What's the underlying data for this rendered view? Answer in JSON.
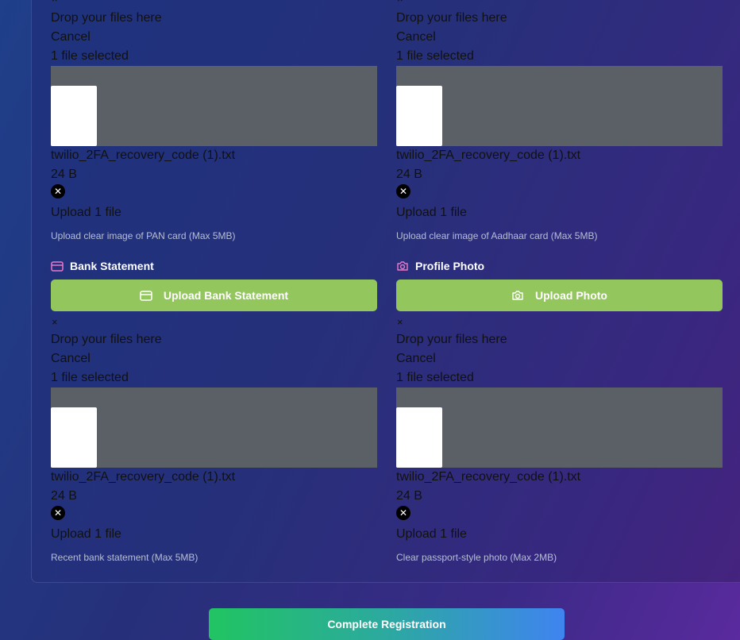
{
  "colors": {
    "upload_button": "#93c65d",
    "label_icon": "#e879c9",
    "thumb_bar": "#5b5f66",
    "submit_start": "#21c462",
    "submit_end": "#3f84f0"
  },
  "uploaders": {
    "pan": {
      "remove_mark": "×",
      "drop_text": "Drop your files here",
      "cancel_text": "Cancel",
      "selected_text": "1 file selected",
      "file_name": "twilio_2FA_recovery_code (1).txt",
      "file_size": "24 B",
      "upload_text": "Upload 1 file",
      "helper": "Upload clear image of PAN card (Max 5MB)"
    },
    "aadhaar": {
      "remove_mark": "×",
      "drop_text": "Drop your files here",
      "cancel_text": "Cancel",
      "selected_text": "1 file selected",
      "file_name": "twilio_2FA_recovery_code (1).txt",
      "file_size": "24 B",
      "upload_text": "Upload 1 file",
      "helper": "Upload clear image of Aadhaar card (Max 5MB)"
    },
    "bank": {
      "label": "Bank Statement",
      "label_icon": "card-icon",
      "button_label": "Upload Bank Statement",
      "button_icon": "card-icon",
      "remove_mark": "×",
      "drop_text": "Drop your files here",
      "cancel_text": "Cancel",
      "selected_text": "1 file selected",
      "file_name": "twilio_2FA_recovery_code (1).txt",
      "file_size": "24 B",
      "upload_text": "Upload 1 file",
      "helper": "Recent bank statement (Max 5MB)"
    },
    "photo": {
      "label": "Profile Photo",
      "label_icon": "camera-icon",
      "button_label": "Upload Photo",
      "button_icon": "camera-icon",
      "remove_mark": "×",
      "drop_text": "Drop your files here",
      "cancel_text": "Cancel",
      "selected_text": "1 file selected",
      "file_name": "twilio_2FA_recovery_code (1).txt",
      "file_size": "24 B",
      "upload_text": "Upload 1 file",
      "helper": "Clear passport-style photo (Max 2MB)"
    }
  },
  "submit": {
    "label": "Complete Registration"
  }
}
